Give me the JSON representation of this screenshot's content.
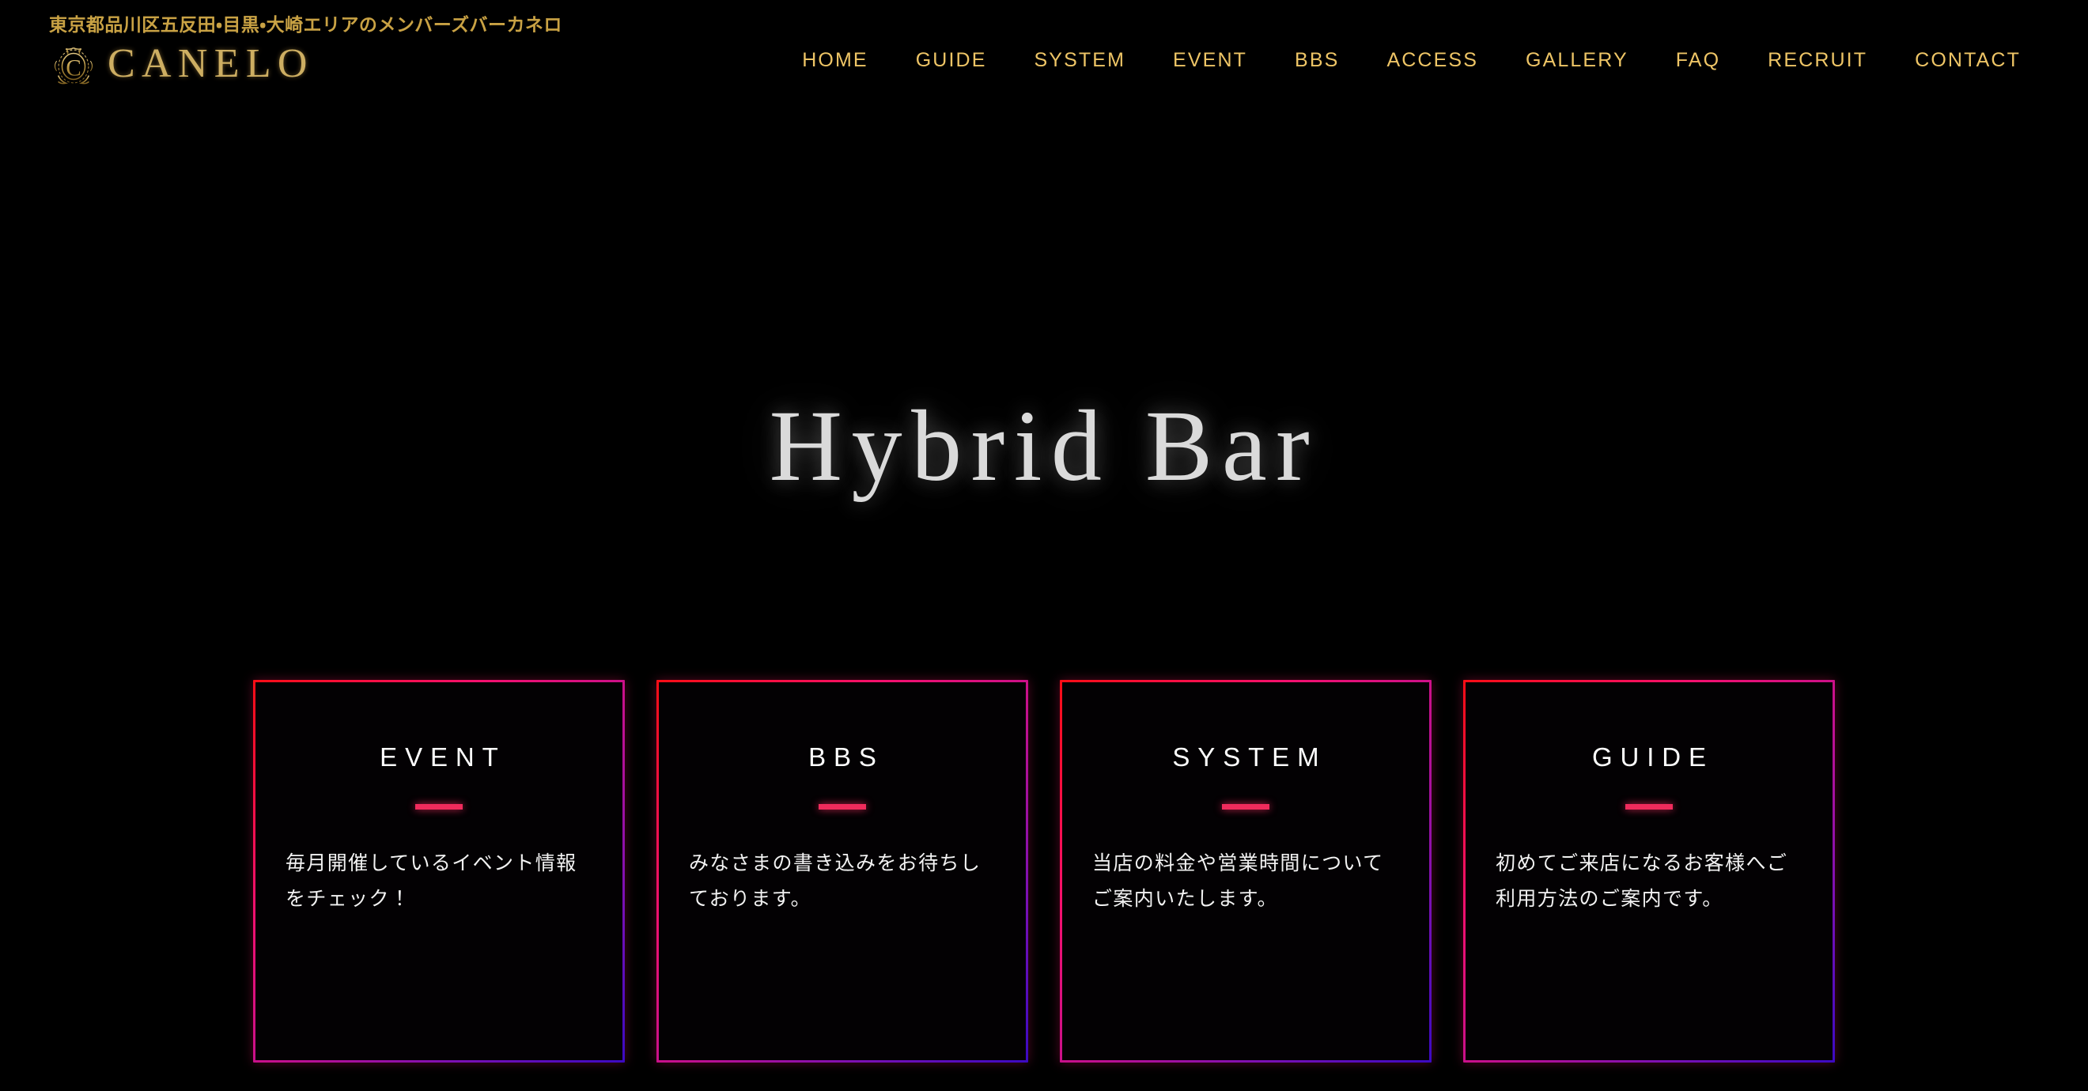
{
  "header": {
    "tagline": "東京都品川区五反田・目黒・大崎エリアのメンバーズバーカネロ",
    "brand_name": "CANELO",
    "emblem_icon": "ornate-c-monogram-icon",
    "brand_color": "#cdae62"
  },
  "nav": {
    "items": [
      {
        "label": "HOME"
      },
      {
        "label": "GUIDE"
      },
      {
        "label": "SYSTEM"
      },
      {
        "label": "EVENT"
      },
      {
        "label": "BBS"
      },
      {
        "label": "ACCESS"
      },
      {
        "label": "GALLERY"
      },
      {
        "label": "FAQ"
      },
      {
        "label": "RECRUIT"
      },
      {
        "label": "CONTACT"
      }
    ],
    "color": "#eec566"
  },
  "hero": {
    "title": "Hybrid Bar",
    "title_color": "#dadada"
  },
  "cards": {
    "accent_rule_color": "#ef2b5c",
    "border_gradient_from": "#ff0d15",
    "border_gradient_to": "#3b0ac2",
    "items": [
      {
        "title": "EVENT",
        "desc": "毎月開催しているイベント情報をチェック！"
      },
      {
        "title": "BBS",
        "desc": "みなさまの書き込みをお待ちしております。"
      },
      {
        "title": "SYSTEM",
        "desc": "当店の料金や営業時間についてご案内いたします。"
      },
      {
        "title": "GUIDE",
        "desc": "初めてご来店になるお客様へご利用方法のご案内です。"
      }
    ]
  }
}
